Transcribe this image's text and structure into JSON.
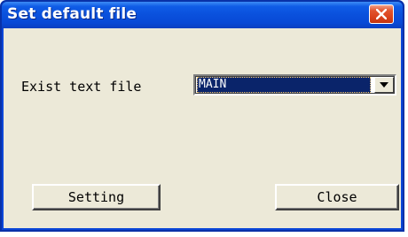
{
  "window": {
    "title": "Set default file"
  },
  "form": {
    "label": "Exist text file",
    "selected_value": "MAIN"
  },
  "buttons": {
    "setting": "Setting",
    "close": "Close"
  },
  "icons": {
    "close": "close-icon",
    "dropdown": "chevron-down-icon"
  },
  "colors": {
    "titlebar": "#0a50dc",
    "close_button": "#d9401a",
    "client_background": "#ece9d8",
    "selection": "#0a246a"
  }
}
